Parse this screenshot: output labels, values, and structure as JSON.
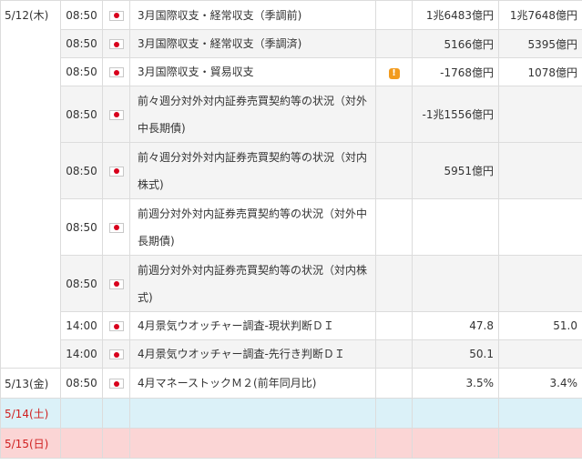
{
  "days": [
    {
      "date": "5/12(木)"
    },
    {
      "date": "5/13(金)"
    },
    {
      "date": "5/14(土)"
    },
    {
      "date": "5/15(日)"
    }
  ],
  "events": [
    {
      "time": "08:50",
      "title": "3月国際収支・経常収支（季調前)",
      "previous": "1兆6483億円",
      "forecast": "1兆7648億円",
      "warning": false
    },
    {
      "time": "08:50",
      "title": "3月国際収支・経常収支（季調済)",
      "previous": "5166億円",
      "forecast": "5395億円",
      "warning": false
    },
    {
      "time": "08:50",
      "title": "3月国際収支・貿易収支",
      "previous": "-1768億円",
      "forecast": "1078億円",
      "warning": true,
      "warning_icon": "!"
    },
    {
      "time": "08:50",
      "title": "前々週分対外対内証券売買契約等の状況（対外中長期債)",
      "previous": "-1兆1556億円",
      "forecast": "",
      "warning": false
    },
    {
      "time": "08:50",
      "title": "前々週分対外対内証券売買契約等の状況（対内株式)",
      "previous": "5951億円",
      "forecast": "",
      "warning": false
    },
    {
      "time": "08:50",
      "title": "前週分対外対内証券売買契約等の状況（対外中長期債)",
      "previous": "",
      "forecast": "",
      "warning": false
    },
    {
      "time": "08:50",
      "title": "前週分対外対内証券売買契約等の状況（対内株式)",
      "previous": "",
      "forecast": "",
      "warning": false
    },
    {
      "time": "14:00",
      "title": "4月景気ウオッチャー調査-現状判断ＤＩ",
      "previous": "47.8",
      "forecast": "51.0",
      "warning": false
    },
    {
      "time": "14:00",
      "title": "4月景気ウオッチャー調査-先行き判断ＤＩ",
      "previous": "50.1",
      "forecast": "",
      "warning": false
    },
    {
      "time": "08:50",
      "title": "4月マネーストックＭ２(前年同月比)",
      "previous": "3.5%",
      "forecast": "3.4%",
      "warning": false
    }
  ],
  "colors": {
    "saturday_bg": "#dbf1f8",
    "sunday_bg": "#fbd5d5",
    "holiday_text": "#d02020",
    "warning": "#f29b1d",
    "flag_red": "#d8001c"
  }
}
